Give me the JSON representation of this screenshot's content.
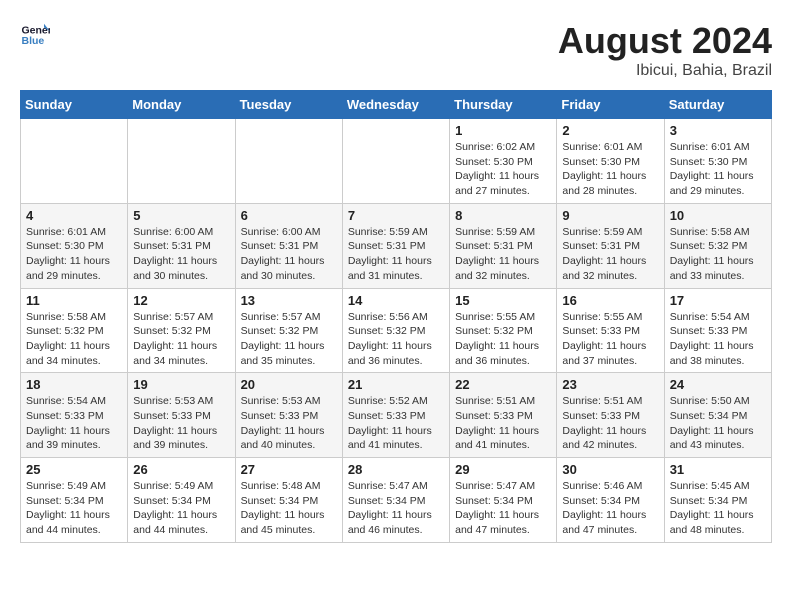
{
  "header": {
    "logo_line1": "General",
    "logo_line2": "Blue",
    "month_year": "August 2024",
    "location": "Ibicui, Bahia, Brazil"
  },
  "days_of_week": [
    "Sunday",
    "Monday",
    "Tuesday",
    "Wednesday",
    "Thursday",
    "Friday",
    "Saturday"
  ],
  "weeks": [
    [
      {
        "day": "",
        "info": ""
      },
      {
        "day": "",
        "info": ""
      },
      {
        "day": "",
        "info": ""
      },
      {
        "day": "",
        "info": ""
      },
      {
        "day": "1",
        "info": "Sunrise: 6:02 AM\nSunset: 5:30 PM\nDaylight: 11 hours\nand 27 minutes."
      },
      {
        "day": "2",
        "info": "Sunrise: 6:01 AM\nSunset: 5:30 PM\nDaylight: 11 hours\nand 28 minutes."
      },
      {
        "day": "3",
        "info": "Sunrise: 6:01 AM\nSunset: 5:30 PM\nDaylight: 11 hours\nand 29 minutes."
      }
    ],
    [
      {
        "day": "4",
        "info": "Sunrise: 6:01 AM\nSunset: 5:30 PM\nDaylight: 11 hours\nand 29 minutes."
      },
      {
        "day": "5",
        "info": "Sunrise: 6:00 AM\nSunset: 5:31 PM\nDaylight: 11 hours\nand 30 minutes."
      },
      {
        "day": "6",
        "info": "Sunrise: 6:00 AM\nSunset: 5:31 PM\nDaylight: 11 hours\nand 30 minutes."
      },
      {
        "day": "7",
        "info": "Sunrise: 5:59 AM\nSunset: 5:31 PM\nDaylight: 11 hours\nand 31 minutes."
      },
      {
        "day": "8",
        "info": "Sunrise: 5:59 AM\nSunset: 5:31 PM\nDaylight: 11 hours\nand 32 minutes."
      },
      {
        "day": "9",
        "info": "Sunrise: 5:59 AM\nSunset: 5:31 PM\nDaylight: 11 hours\nand 32 minutes."
      },
      {
        "day": "10",
        "info": "Sunrise: 5:58 AM\nSunset: 5:32 PM\nDaylight: 11 hours\nand 33 minutes."
      }
    ],
    [
      {
        "day": "11",
        "info": "Sunrise: 5:58 AM\nSunset: 5:32 PM\nDaylight: 11 hours\nand 34 minutes."
      },
      {
        "day": "12",
        "info": "Sunrise: 5:57 AM\nSunset: 5:32 PM\nDaylight: 11 hours\nand 34 minutes."
      },
      {
        "day": "13",
        "info": "Sunrise: 5:57 AM\nSunset: 5:32 PM\nDaylight: 11 hours\nand 35 minutes."
      },
      {
        "day": "14",
        "info": "Sunrise: 5:56 AM\nSunset: 5:32 PM\nDaylight: 11 hours\nand 36 minutes."
      },
      {
        "day": "15",
        "info": "Sunrise: 5:55 AM\nSunset: 5:32 PM\nDaylight: 11 hours\nand 36 minutes."
      },
      {
        "day": "16",
        "info": "Sunrise: 5:55 AM\nSunset: 5:33 PM\nDaylight: 11 hours\nand 37 minutes."
      },
      {
        "day": "17",
        "info": "Sunrise: 5:54 AM\nSunset: 5:33 PM\nDaylight: 11 hours\nand 38 minutes."
      }
    ],
    [
      {
        "day": "18",
        "info": "Sunrise: 5:54 AM\nSunset: 5:33 PM\nDaylight: 11 hours\nand 39 minutes."
      },
      {
        "day": "19",
        "info": "Sunrise: 5:53 AM\nSunset: 5:33 PM\nDaylight: 11 hours\nand 39 minutes."
      },
      {
        "day": "20",
        "info": "Sunrise: 5:53 AM\nSunset: 5:33 PM\nDaylight: 11 hours\nand 40 minutes."
      },
      {
        "day": "21",
        "info": "Sunrise: 5:52 AM\nSunset: 5:33 PM\nDaylight: 11 hours\nand 41 minutes."
      },
      {
        "day": "22",
        "info": "Sunrise: 5:51 AM\nSunset: 5:33 PM\nDaylight: 11 hours\nand 41 minutes."
      },
      {
        "day": "23",
        "info": "Sunrise: 5:51 AM\nSunset: 5:33 PM\nDaylight: 11 hours\nand 42 minutes."
      },
      {
        "day": "24",
        "info": "Sunrise: 5:50 AM\nSunset: 5:34 PM\nDaylight: 11 hours\nand 43 minutes."
      }
    ],
    [
      {
        "day": "25",
        "info": "Sunrise: 5:49 AM\nSunset: 5:34 PM\nDaylight: 11 hours\nand 44 minutes."
      },
      {
        "day": "26",
        "info": "Sunrise: 5:49 AM\nSunset: 5:34 PM\nDaylight: 11 hours\nand 44 minutes."
      },
      {
        "day": "27",
        "info": "Sunrise: 5:48 AM\nSunset: 5:34 PM\nDaylight: 11 hours\nand 45 minutes."
      },
      {
        "day": "28",
        "info": "Sunrise: 5:47 AM\nSunset: 5:34 PM\nDaylight: 11 hours\nand 46 minutes."
      },
      {
        "day": "29",
        "info": "Sunrise: 5:47 AM\nSunset: 5:34 PM\nDaylight: 11 hours\nand 47 minutes."
      },
      {
        "day": "30",
        "info": "Sunrise: 5:46 AM\nSunset: 5:34 PM\nDaylight: 11 hours\nand 47 minutes."
      },
      {
        "day": "31",
        "info": "Sunrise: 5:45 AM\nSunset: 5:34 PM\nDaylight: 11 hours\nand 48 minutes."
      }
    ]
  ]
}
